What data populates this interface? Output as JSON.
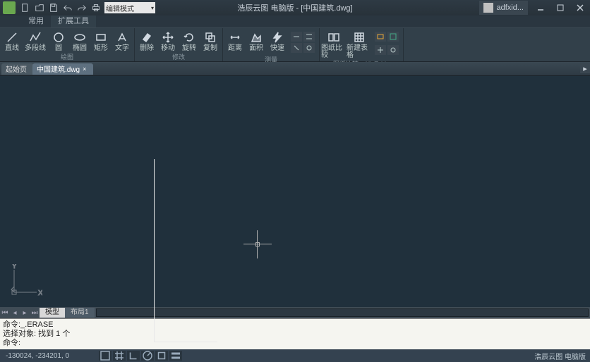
{
  "title": "浩辰云图 电脑版 - [中国建筑.dwg]",
  "user": "adfxid...",
  "edit_mode": "编辑模式",
  "ribbon_tabs": {
    "t0": "常用",
    "t1": "扩展工具"
  },
  "ribbon": {
    "g0": {
      "b0": "直线",
      "b1": "多段线",
      "b2": "圆",
      "b3": "椭圆",
      "b4": "矩形",
      "b5": "文字",
      "label": "绘图"
    },
    "g1": {
      "b0": "删除",
      "b1": "移动",
      "b2": "旋转",
      "b3": "复制",
      "label": "修改"
    },
    "g2": {
      "b0": "距离",
      "b1": "面积",
      "b2": "快速",
      "label": "测量"
    },
    "g3": {
      "b0": "图纸比较",
      "b1": "新建表格",
      "label": "图纸比较",
      "label2": "XlsTable"
    }
  },
  "filetabs": {
    "home": "起始页",
    "t1": "中国建筑.dwg"
  },
  "layout": {
    "model": "模型",
    "l1": "布局1"
  },
  "cmd": {
    "l0": "命令:_.ERASE",
    "l1": "选择对象: 找到 1 个",
    "l2": "命令:"
  },
  "status": {
    "coord": "-130024, -234201, 0",
    "brand": "浩辰云图 电脑版"
  }
}
